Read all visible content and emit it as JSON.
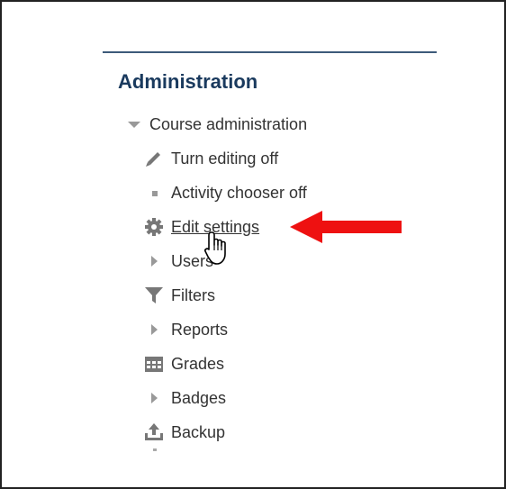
{
  "block": {
    "title": "Administration"
  },
  "course_admin": {
    "label": "Course administration",
    "items": [
      {
        "label": "Turn editing off",
        "icon": "pencil-icon"
      },
      {
        "label": "Activity chooser off",
        "icon": "bullet-icon"
      },
      {
        "label": "Edit settings",
        "icon": "gear-icon"
      },
      {
        "label": "Users",
        "icon": "caret-right-icon"
      },
      {
        "label": "Filters",
        "icon": "filter-icon"
      },
      {
        "label": "Reports",
        "icon": "caret-right-icon"
      },
      {
        "label": "Grades",
        "icon": "grades-table-icon"
      },
      {
        "label": "Badges",
        "icon": "caret-right-icon"
      },
      {
        "label": "Backup",
        "icon": "backup-upload-icon"
      }
    ]
  },
  "colors": {
    "title": "#1a3a5e",
    "text": "#333333",
    "icon": "#777777",
    "arrow": "#ee1111",
    "divider": "#3d5a7a"
  }
}
